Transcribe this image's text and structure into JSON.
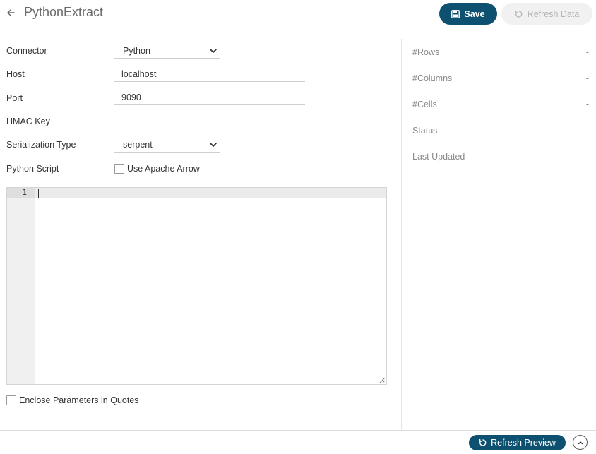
{
  "header": {
    "title": "PythonExtract",
    "save_label": "Save",
    "refresh_data_label": "Refresh Data"
  },
  "form": {
    "connector": {
      "label": "Connector",
      "value": "Python"
    },
    "host": {
      "label": "Host",
      "value": "localhost"
    },
    "port": {
      "label": "Port",
      "value": "9090"
    },
    "hmac": {
      "label": "HMAC Key",
      "value": ""
    },
    "serialization": {
      "label": "Serialization Type",
      "value": "serpent"
    },
    "script": {
      "label": "Python Script",
      "arrow_label": "Use Apache Arrow"
    }
  },
  "editor": {
    "line_numbers": [
      "1"
    ]
  },
  "enclose_label": "Enclose Parameters in Quotes",
  "stats": [
    {
      "label": "#Rows",
      "value": "-"
    },
    {
      "label": "#Columns",
      "value": "-"
    },
    {
      "label": "#Cells",
      "value": "-"
    },
    {
      "label": "Status",
      "value": "-"
    },
    {
      "label": "Last Updated",
      "value": "-"
    }
  ],
  "footer": {
    "refresh_preview_label": "Refresh Preview"
  },
  "colors": {
    "primary": "#0e5070",
    "disabled_bg": "#f1f1f1",
    "muted_text": "#8a8a8a"
  }
}
